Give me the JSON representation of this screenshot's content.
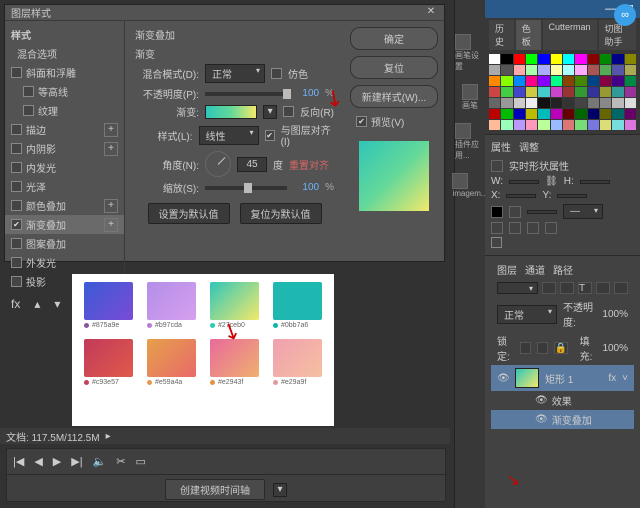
{
  "dialog": {
    "title": "图层样式",
    "styles_header": "样式",
    "blend_options": "混合选项",
    "items": [
      {
        "label": "斜面和浮雕",
        "checked": false
      },
      {
        "label": "等高线",
        "checked": false,
        "indent": true
      },
      {
        "label": "纹理",
        "checked": false,
        "indent": true
      },
      {
        "label": "描边",
        "checked": false,
        "plus": true
      },
      {
        "label": "内阴影",
        "checked": false,
        "plus": true
      },
      {
        "label": "内发光",
        "checked": false
      },
      {
        "label": "光泽",
        "checked": false
      },
      {
        "label": "颜色叠加",
        "checked": false,
        "plus": true
      },
      {
        "label": "渐变叠加",
        "checked": true,
        "plus": true,
        "selected": true
      },
      {
        "label": "图案叠加",
        "checked": false
      },
      {
        "label": "外发光",
        "checked": false
      },
      {
        "label": "投影",
        "checked": false,
        "plus": true
      }
    ],
    "center": {
      "section_title": "渐变叠加",
      "subsection": "渐变",
      "blend_mode_label": "混合模式(D):",
      "blend_mode_value": "正常",
      "dither": "仿色",
      "opacity_label": "不透明度(P):",
      "opacity_value": "100",
      "pct": "%",
      "gradient_label": "渐变:",
      "reverse": "反向(R)",
      "style_label": "样式(L):",
      "style_value": "线性",
      "align": "与图层对齐(I)",
      "angle_label": "角度(N):",
      "angle_value": "45",
      "deg": "度",
      "reset_align": "重置对齐",
      "scale_label": "缩放(S):",
      "scale_value": "100",
      "make_default": "设置为默认值",
      "reset_default": "复位为默认值"
    },
    "right": {
      "ok": "确定",
      "cancel": "复位",
      "new_style": "新建样式(W)...",
      "preview": "预览(V)"
    }
  },
  "canvas_swatches": [
    {
      "g": "linear-gradient(135deg,#3b5bd6,#7a4bd6)",
      "code": "#875a9e",
      "d": "#875a9e"
    },
    {
      "g": "linear-gradient(135deg,#b38ee8,#d6a0ef)",
      "code": "#b97cda",
      "d": "#b97cda"
    },
    {
      "g": "linear-gradient(135deg,#2fc6b8,#f3e96b)",
      "code": "#27ceb0",
      "d": "#27ceb0"
    },
    {
      "g": "linear-gradient(135deg,#1fb8b0,#1fb8b0)",
      "code": "#0bb7a6",
      "d": "#0bb7a6"
    },
    {
      "g": "linear-gradient(135deg,#c23a5a,#e05a4a)",
      "code": "#c93e57",
      "d": "#c93e57"
    },
    {
      "g": "linear-gradient(135deg,#e6a04a,#e86a6a)",
      "code": "#e59a4a",
      "d": "#e59a4a"
    },
    {
      "g": "linear-gradient(135deg,#e86a9a,#f0b070)",
      "code": "#e2943f",
      "d": "#e2943f"
    },
    {
      "g": "linear-gradient(135deg,#f0a0b0,#f5c0a0)",
      "code": "#e29a9f",
      "d": "#e29a9f"
    }
  ],
  "statusbar": {
    "zoom": "文档: 117.5M/112.5M",
    "arrow": "▸"
  },
  "timeline": {
    "create_btn": "创建视频时间轴",
    "dd": "▾"
  },
  "extensions": [
    {
      "label": "画笔设置"
    },
    {
      "label": "画笔"
    },
    {
      "label": "插件应用..."
    },
    {
      "label": "imagem..."
    }
  ],
  "top_tabs": {
    "a": "历史",
    "b": "色板",
    "c": "Cutterman",
    "d": "切图助手"
  },
  "swatch_colors": [
    "#fff",
    "#000",
    "#f00",
    "#0f0",
    "#00f",
    "#ff0",
    "#0ff",
    "#f0f",
    "#800",
    "#080",
    "#008",
    "#880",
    "#aaa",
    "#555",
    "#faa",
    "#afa",
    "#aaf",
    "#ffa",
    "#aff",
    "#faf",
    "#a55",
    "#5a5",
    "#55a",
    "#aa5",
    "#f80",
    "#8f0",
    "#08f",
    "#f08",
    "#80f",
    "#0f8",
    "#840",
    "#480",
    "#048",
    "#804",
    "#408",
    "#084",
    "#c44",
    "#4c4",
    "#44c",
    "#cc4",
    "#4cc",
    "#c4c",
    "#933",
    "#393",
    "#339",
    "#993",
    "#399",
    "#939",
    "#666",
    "#999",
    "#ccc",
    "#eee",
    "#111",
    "#222",
    "#333",
    "#444",
    "#777",
    "#888",
    "#bbb",
    "#ddd",
    "#b00",
    "#0b0",
    "#00b",
    "#bb0",
    "#0bb",
    "#b0b",
    "#600",
    "#060",
    "#006",
    "#660",
    "#066",
    "#606",
    "#fb9",
    "#9fb",
    "#b9f",
    "#f9b",
    "#bf9",
    "#9bf",
    "#d77",
    "#7d7",
    "#77d",
    "#dd7",
    "#7dd",
    "#d7d"
  ],
  "properties": {
    "tabs": {
      "a": "属性",
      "b": "调整"
    },
    "sub": "实时形状属性",
    "w": "W:",
    "h": "H:",
    "x": "X:",
    "y": "Y:"
  },
  "layers": {
    "tabs": {
      "a": "图层",
      "b": "通道",
      "c": "路径"
    },
    "kind": "正常",
    "opacity_label": "不透明度:",
    "opacity": "100%",
    "lock": "锁定:",
    "fill_label": "填充:",
    "fill": "100%",
    "layer_name": "矩形 1",
    "fx": "fx",
    "effects": "效果",
    "grad_overlay": "渐变叠加"
  },
  "cloud_icon": "∞"
}
